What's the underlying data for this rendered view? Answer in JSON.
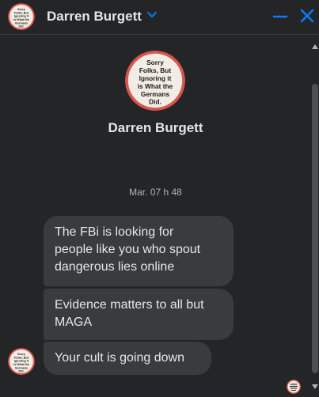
{
  "header": {
    "contact_name": "Darren Burgett"
  },
  "profile": {
    "name": "Darren Burgett",
    "avatar_text": [
      "Sorry",
      "Folks, But",
      "Ignoring it",
      "is What the",
      "Germans",
      "Did."
    ]
  },
  "conversation": {
    "timestamp": "Mar. 07 h 48",
    "messages": [
      {
        "text": "The FBi is looking for\npeople like you who spout\ndangerous lies online"
      },
      {
        "text": "Evidence matters to all but\nMAGA"
      },
      {
        "text": "Your cult is going down"
      }
    ]
  },
  "colors": {
    "background": "#242526",
    "bubble": "#3a3b3c",
    "text": "#e4e6eb",
    "muted_text": "#b0b3b8",
    "accent": "#0a7cff",
    "avatar_bg": "#f1ece4",
    "avatar_ring": "#d9534f"
  },
  "icons": {
    "chevron": "chevron-down-icon",
    "minimize": "minimize-icon",
    "close": "close-icon"
  }
}
